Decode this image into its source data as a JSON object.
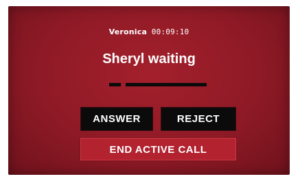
{
  "call": {
    "caller_name": "Veronica",
    "timer": "00:09:10",
    "waiting_text": "Sheryl waiting"
  },
  "buttons": {
    "answer_label": "ANSWER",
    "reject_label": "REJECT",
    "end_label": "END ACTIVE CALL"
  },
  "colors": {
    "background": "#8e1a26",
    "button_dark": "#0b0b0b",
    "button_end": "#b2222f",
    "text": "#ffffff"
  }
}
